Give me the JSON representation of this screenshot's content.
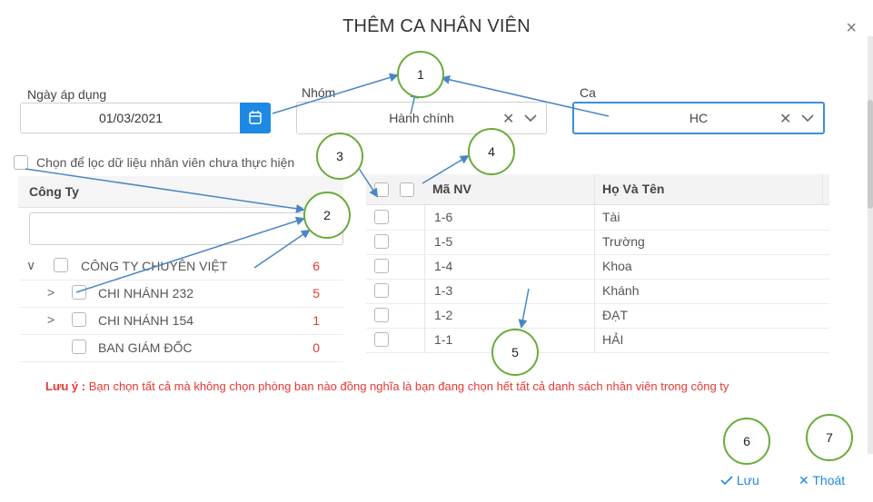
{
  "dialog": {
    "title": "THÊM CA NHÂN VIÊN",
    "close_icon": "×"
  },
  "fields": {
    "date": {
      "label": "Ngày áp dụng",
      "value": "01/03/2021"
    },
    "group": {
      "label": "Nhóm",
      "value": "Hành chính"
    },
    "shift": {
      "label": "Ca",
      "value": "HC"
    }
  },
  "filter_checkbox_label": "Chọn để lọc dữ liệu nhân viên chưa thực hiện",
  "tree": {
    "header": "Công Ty",
    "search_placeholder": "",
    "items": [
      {
        "name": "CÔNG TY CHUYÊN VIỆT",
        "count": "6",
        "expander": "∨"
      },
      {
        "name": "CHI NHÁNH 232",
        "count": "5",
        "expander": ">"
      },
      {
        "name": "CHI NHÁNH 154",
        "count": "1",
        "expander": ">"
      },
      {
        "name": "BAN GIÁM ĐỐC",
        "count": "0",
        "expander": ""
      }
    ]
  },
  "table": {
    "columns": {
      "code": "Mã NV",
      "name": "Họ Và Tên"
    },
    "rows": [
      {
        "code": "1-6",
        "name": "Tài"
      },
      {
        "code": "1-5",
        "name": "Trường"
      },
      {
        "code": "1-4",
        "name": "Khoa"
      },
      {
        "code": "1-3",
        "name": "Khánh"
      },
      {
        "code": "1-2",
        "name": "ĐẠT"
      },
      {
        "code": "1-1",
        "name": "HẢI"
      }
    ]
  },
  "note": {
    "prefix": "Lưu ý :",
    "text": "Bạn chọn tất cả mà không chọn phòng ban nào đồng nghĩa là bạn đang chọn hết tất cả danh sách nhân viên trong công ty"
  },
  "actions": {
    "save": "Lưu",
    "exit": "Thoát"
  },
  "callouts": [
    "1",
    "2",
    "3",
    "4",
    "5",
    "6",
    "7"
  ],
  "colors": {
    "accent": "#1e88e5",
    "count": "#e53935",
    "callout_border": "#6aab3a",
    "arrow": "#4a86c5"
  }
}
